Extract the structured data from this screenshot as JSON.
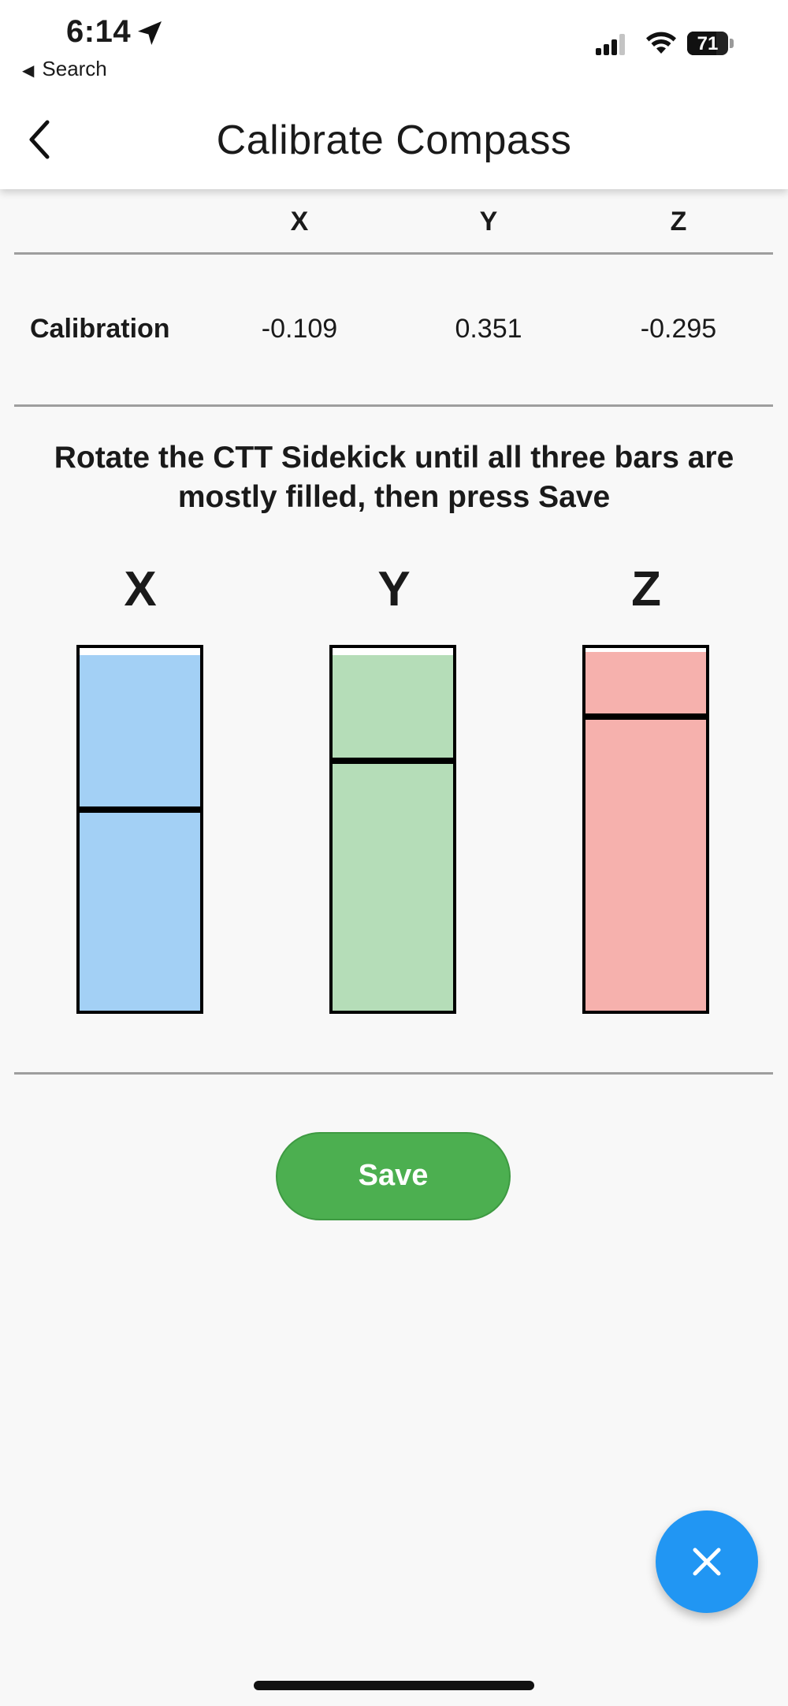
{
  "status_bar": {
    "time": "6:14",
    "back_app_label": "Search",
    "battery_percent": "71"
  },
  "header": {
    "title": "Calibrate Compass"
  },
  "table": {
    "columns": [
      "X",
      "Y",
      "Z"
    ],
    "row_label": "Calibration",
    "values": [
      "-0.109",
      "0.351",
      "-0.295"
    ]
  },
  "instruction": "Rotate the CTT Sidekick until all three bars are mostly filled, then press Save",
  "bars": [
    {
      "label": "X",
      "color": "#a3d0f5",
      "fill_fraction": 0.98,
      "marker_fraction": 0.555
    },
    {
      "label": "Y",
      "color": "#b5ddb8",
      "fill_fraction": 0.98,
      "marker_fraction": 0.69
    },
    {
      "label": "Z",
      "color": "#f6b1ad",
      "fill_fraction": 0.99,
      "marker_fraction": 0.81
    }
  ],
  "save_label": "Save",
  "colors": {
    "accent_green": "#4caf50",
    "fab_blue": "#2196f3"
  },
  "icons": {
    "back": "chevron-left-icon",
    "fab": "close-icon",
    "location": "location-arrow-icon"
  }
}
